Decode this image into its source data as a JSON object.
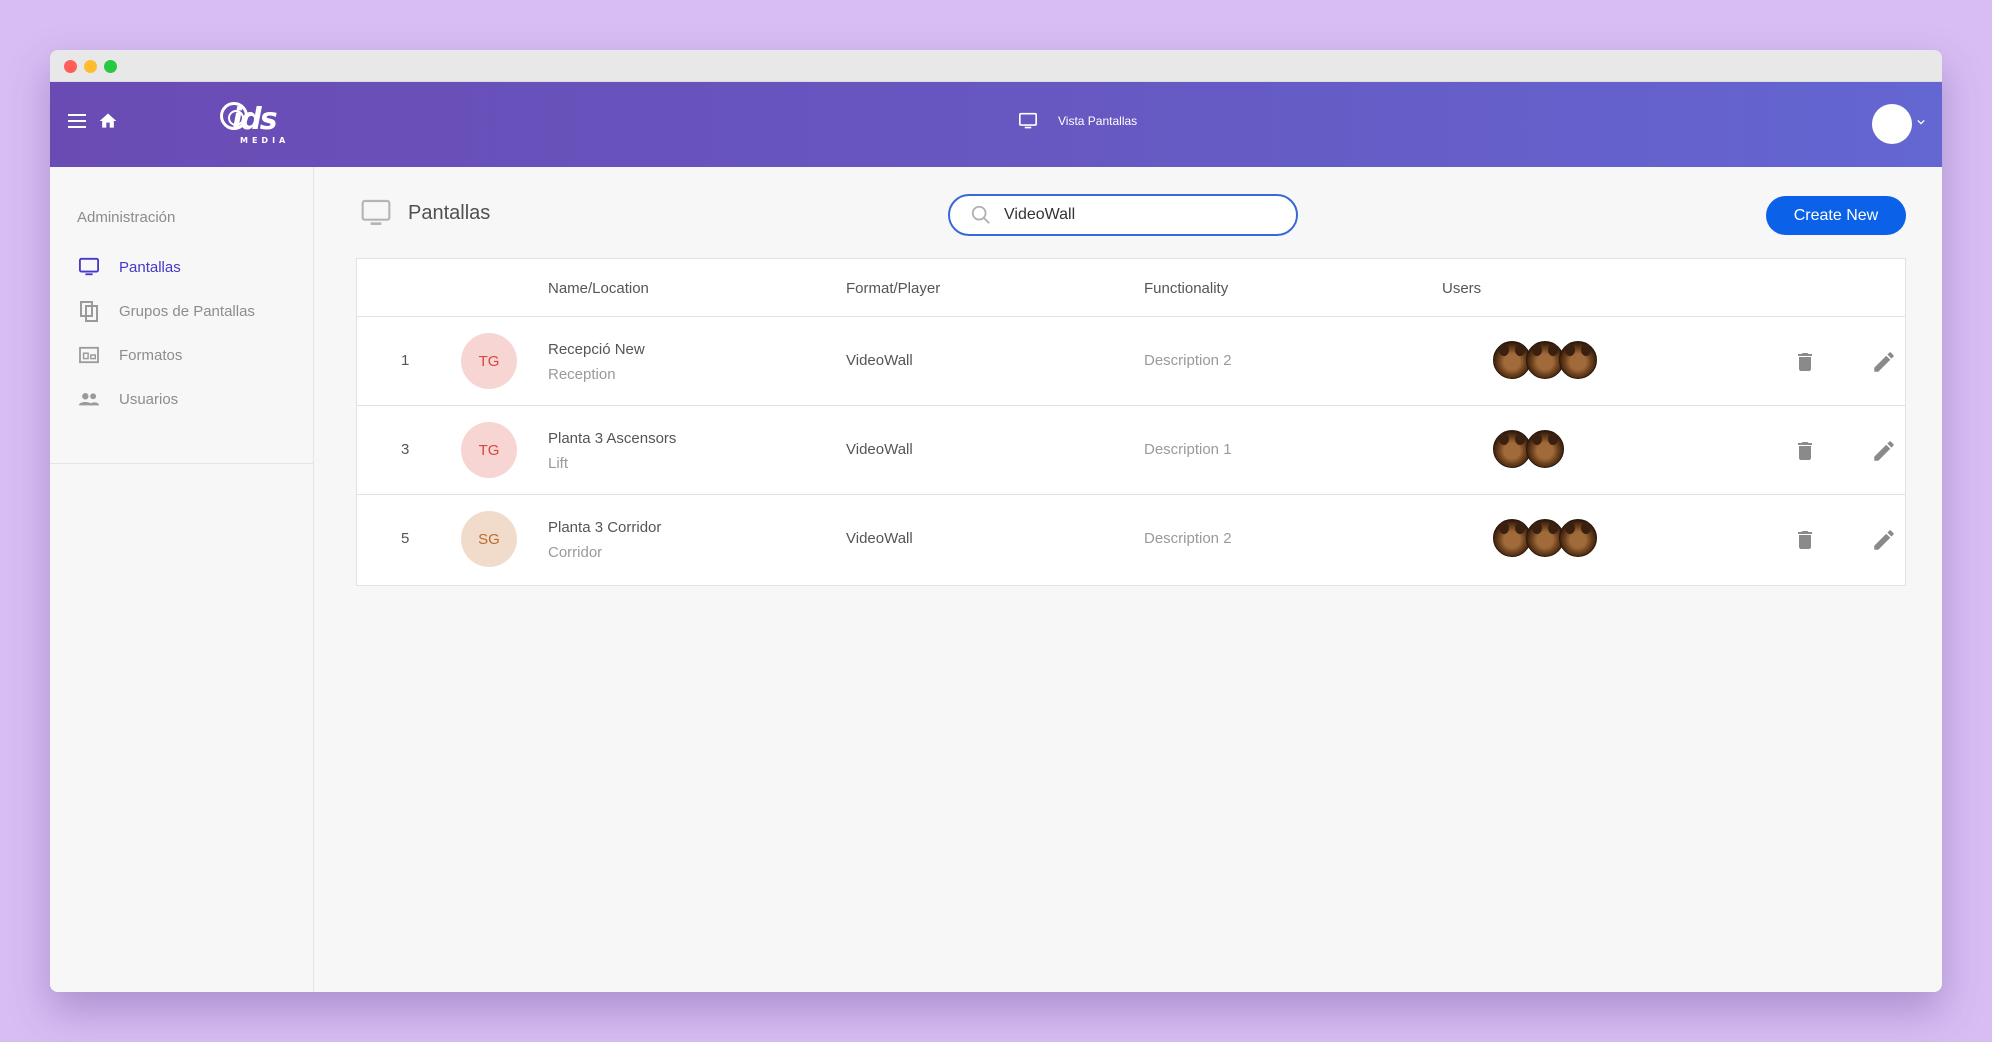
{
  "header": {
    "logo_text": "ids",
    "logo_sub": "MEDIA",
    "center_title": "Vista Pantallas"
  },
  "sidebar": {
    "heading": "Administración",
    "items": [
      {
        "label": "Pantallas",
        "icon": "monitor-icon",
        "active": true
      },
      {
        "label": "Grupos de Pantallas",
        "icon": "copy-icon",
        "active": false
      },
      {
        "label": "Formatos",
        "icon": "formats-icon",
        "active": false
      },
      {
        "label": "Usuarios",
        "icon": "people-icon",
        "active": false
      }
    ]
  },
  "page": {
    "title": "Pantallas",
    "search_value": "VideoWall",
    "create_label": "Create New"
  },
  "table": {
    "headers": [
      "Name/Location",
      "Format/Player",
      "Functionality",
      "Users"
    ],
    "rows": [
      {
        "num": "1",
        "badge": "TG",
        "name": "Recepció New",
        "location": "Reception",
        "format": "VideoWall",
        "functionality": "Description 2",
        "users": 3
      },
      {
        "num": "3",
        "badge": "TG",
        "name": "Planta 3 Ascensors",
        "location": "Lift",
        "format": "VideoWall",
        "functionality": "Description 1",
        "users": 2
      },
      {
        "num": "5",
        "badge": "SG",
        "name": "Planta 3 Corridor",
        "location": "Corridor",
        "format": "VideoWall",
        "functionality": "Description 2",
        "users": 3
      }
    ]
  },
  "colors": {
    "accent": "#0b62e8",
    "active_nav": "#4638c8",
    "badge_tg_bg": "#f6d5d3",
    "badge_tg_fg": "#d9453f",
    "badge_sg_bg": "#f1dccc",
    "badge_sg_fg": "#c06a2c"
  }
}
